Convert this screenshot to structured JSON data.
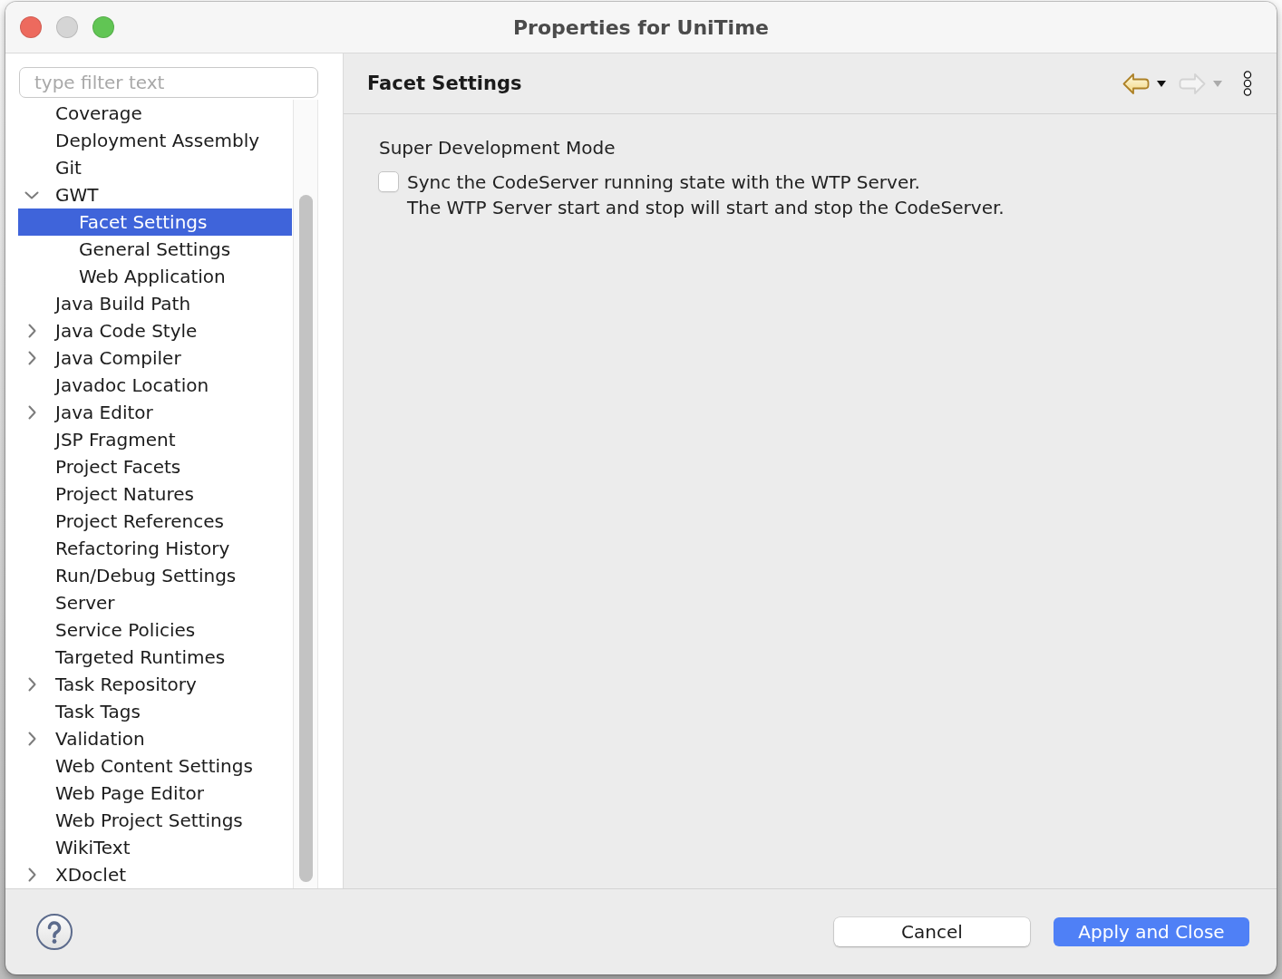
{
  "window": {
    "title": "Properties for UniTime",
    "controls": [
      {
        "kind": "close",
        "disabled": false
      },
      {
        "kind": "minimize",
        "disabled": true
      },
      {
        "kind": "zoom",
        "disabled": false
      }
    ]
  },
  "filter": {
    "placeholder": "type filter text"
  },
  "tree": {
    "items": [
      {
        "label": "Coverage",
        "kind": "leaf",
        "expanded": false,
        "selected": false
      },
      {
        "label": "Deployment Assembly",
        "kind": "leaf",
        "expanded": false,
        "selected": false
      },
      {
        "label": "Git",
        "kind": "leaf",
        "expanded": false,
        "selected": false
      },
      {
        "label": "GWT",
        "kind": "branch",
        "expanded": true,
        "selected": false,
        "children": [
          {
            "label": "Facet Settings",
            "kind": "leaf",
            "expanded": false,
            "selected": true
          },
          {
            "label": "General Settings",
            "kind": "leaf",
            "expanded": false,
            "selected": false
          },
          {
            "label": "Web Application",
            "kind": "leaf",
            "expanded": false,
            "selected": false
          }
        ]
      },
      {
        "label": "Java Build Path",
        "kind": "leaf",
        "expanded": false,
        "selected": false
      },
      {
        "label": "Java Code Style",
        "kind": "branch",
        "expanded": false,
        "selected": false
      },
      {
        "label": "Java Compiler",
        "kind": "branch",
        "expanded": false,
        "selected": false
      },
      {
        "label": "Javadoc Location",
        "kind": "leaf",
        "expanded": false,
        "selected": false
      },
      {
        "label": "Java Editor",
        "kind": "branch",
        "expanded": false,
        "selected": false
      },
      {
        "label": "JSP Fragment",
        "kind": "leaf",
        "expanded": false,
        "selected": false
      },
      {
        "label": "Project Facets",
        "kind": "leaf",
        "expanded": false,
        "selected": false
      },
      {
        "label": "Project Natures",
        "kind": "leaf",
        "expanded": false,
        "selected": false
      },
      {
        "label": "Project References",
        "kind": "leaf",
        "expanded": false,
        "selected": false
      },
      {
        "label": "Refactoring History",
        "kind": "leaf",
        "expanded": false,
        "selected": false
      },
      {
        "label": "Run/Debug Settings",
        "kind": "leaf",
        "expanded": false,
        "selected": false
      },
      {
        "label": "Server",
        "kind": "leaf",
        "expanded": false,
        "selected": false
      },
      {
        "label": "Service Policies",
        "kind": "leaf",
        "expanded": false,
        "selected": false
      },
      {
        "label": "Targeted Runtimes",
        "kind": "leaf",
        "expanded": false,
        "selected": false
      },
      {
        "label": "Task Repository",
        "kind": "branch",
        "expanded": false,
        "selected": false
      },
      {
        "label": "Task Tags",
        "kind": "leaf",
        "expanded": false,
        "selected": false
      },
      {
        "label": "Validation",
        "kind": "branch",
        "expanded": false,
        "selected": false
      },
      {
        "label": "Web Content Settings",
        "kind": "leaf",
        "expanded": false,
        "selected": false
      },
      {
        "label": "Web Page Editor",
        "kind": "leaf",
        "expanded": false,
        "selected": false
      },
      {
        "label": "Web Project Settings",
        "kind": "leaf",
        "expanded": false,
        "selected": false
      },
      {
        "label": "WikiText",
        "kind": "leaf",
        "expanded": false,
        "selected": false
      },
      {
        "label": "XDoclet",
        "kind": "branch",
        "expanded": false,
        "selected": false
      }
    ]
  },
  "page": {
    "title": "Facet Settings",
    "toolbar": [
      {
        "kind": "back",
        "disabled": false
      },
      {
        "kind": "forward",
        "disabled": true
      },
      {
        "kind": "menu",
        "disabled": false
      }
    ]
  },
  "settings": {
    "title": "Super Development Mode",
    "options": [
      {
        "label": "Sync the CodeServer running state with the WTP Server.\nThe WTP Server start and stop will start and stop the CodeServer.",
        "checked": false
      }
    ]
  },
  "footer": {
    "buttons": [
      {
        "kind": "help"
      },
      {
        "label": "Cancel",
        "kind": "secondary"
      },
      {
        "label": "Apply and Close",
        "kind": "primary"
      }
    ]
  }
}
